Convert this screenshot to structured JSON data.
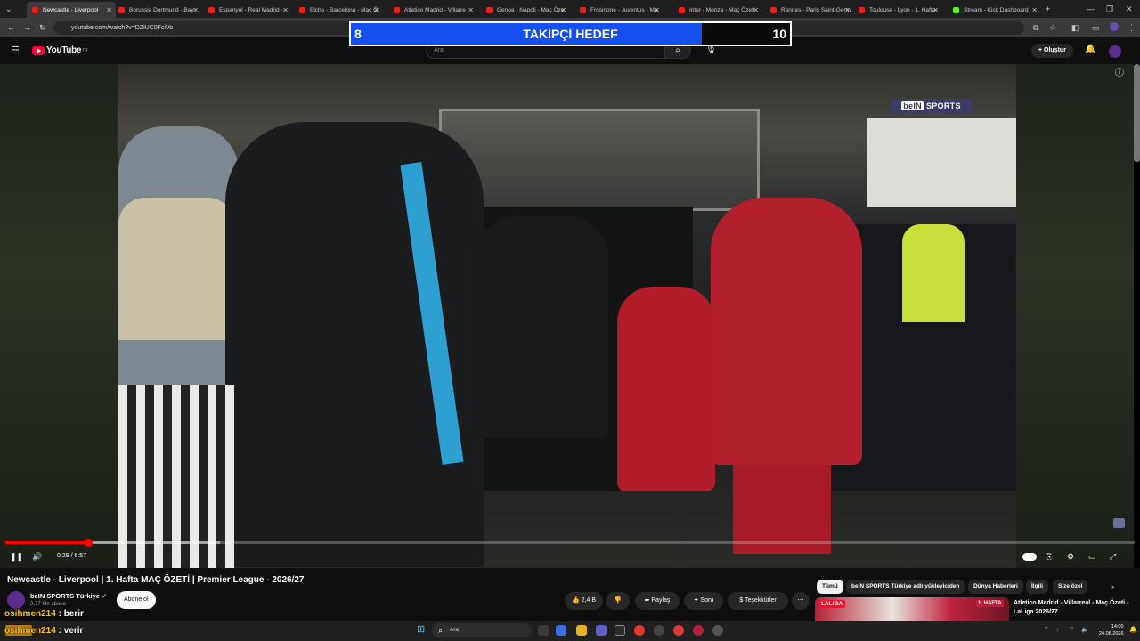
{
  "browser": {
    "tabs": [
      {
        "label": "Newcastle - Liverpool",
        "active": true
      },
      {
        "label": "Borussia Dortmund - Bay"
      },
      {
        "label": "Espanyol - Real Madrid -"
      },
      {
        "label": "Elche - Barcelona - Maç Ö"
      },
      {
        "label": "Atletico Madrid - Villarre"
      },
      {
        "label": "Genoa - Napoli - Maç Öze"
      },
      {
        "label": "Frosinone - Juventus - Ma"
      },
      {
        "label": "Inter - Monza - Maç Özeti"
      },
      {
        "label": "Rennes - Paris Saint-Germ"
      },
      {
        "label": "Toulouse - Lyon - 1. Hafta"
      },
      {
        "label": "Stream - Kick Dashboard",
        "kick": true
      }
    ],
    "new_tab": "+",
    "url": "youtube.com/watch?v=DZiUC0FciVo",
    "window_controls": [
      "—",
      "❐",
      "✕"
    ]
  },
  "overlay": {
    "current": "8",
    "title": "TAKİPÇİ HEDEF",
    "goal": "10",
    "progress": 0.8
  },
  "youtube": {
    "logo": "YouTube",
    "logo_sup": "TR",
    "search_placeholder": "Ara",
    "create_label": "Oluştur",
    "video": {
      "watermark_brand": "beIN",
      "watermark_text": "SPORTS",
      "time": "0:29 / 6:57",
      "progress": 0.073,
      "buffered": 0.19,
      "title": "Newcastle - Liverpool | 1. Hafta MAÇ ÖZETİ | Premier League - 2026/27"
    },
    "channel": {
      "name": "beIN SPORTS Türkiye",
      "subscribers": "2,77 Mn abone",
      "subscribe_label": "Abone ol"
    },
    "actions": {
      "likes": "2,4 B",
      "share": "Paylaş",
      "ask": "Soru",
      "thanks": "Teşekkürler",
      "more": "⋯"
    },
    "chips": [
      "Tümü",
      "beIN SPORTS Türkiye adlı yükleyiciden",
      "Dünya Haberleri",
      "İlgili",
      "Size özel"
    ],
    "recommended": {
      "title": "Atletico Madrid - Villarreal - Maç Özeti - LaLiga 2026/27",
      "badge": "LALIGA",
      "week": "1. HAFTA"
    }
  },
  "chat": [
    {
      "user": "osihmen214",
      "message": "berir"
    },
    {
      "user": "osihmen214",
      "message": "verir"
    }
  ],
  "taskbar": {
    "search": "Ara",
    "time": "14:00",
    "date": "24.08.2026"
  },
  "colors": {
    "accent_red": "#ff0000",
    "overlay_blue": "#1450f0",
    "liverpool_red": "#c8102e"
  }
}
